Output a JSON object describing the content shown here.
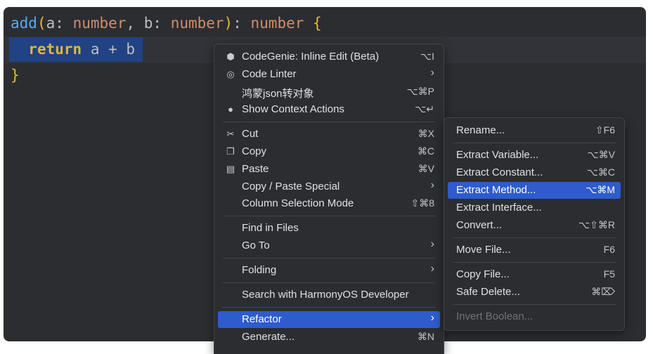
{
  "code": {
    "line1": {
      "fn": "add",
      "open": "(",
      "p1": "a",
      "colon1": ":",
      "t1": "number",
      "comma": ", ",
      "p2": "b",
      "colon2": ":",
      "t2": "number",
      "close": ")",
      "colon3": ":",
      "rt": "number",
      "brace": "{"
    },
    "line2": {
      "kw": "return",
      "expr": "a + b"
    },
    "line3": {
      "brace": "}"
    }
  },
  "context_menu": {
    "items": [
      {
        "label": "CodeGenie: Inline Edit (Beta)",
        "shortcut": "⌥I",
        "icon": "codegenie-icon"
      },
      {
        "label": "Code Linter",
        "icon": "code-linter-icon",
        "submenu": "›"
      },
      {
        "label": "鸿蒙json转对象",
        "shortcut": "⌥⌘P"
      },
      {
        "label": "Show Context Actions",
        "shortcut": "⌥↵",
        "icon": "bulb-icon"
      },
      {
        "label": "Cut",
        "shortcut": "⌘X",
        "icon": "scissors-icon"
      },
      {
        "label": "Copy",
        "shortcut": "⌘C",
        "icon": "copy-icon"
      },
      {
        "label": "Paste",
        "shortcut": "⌘V",
        "icon": "clipboard-icon"
      },
      {
        "label": "Copy / Paste Special",
        "submenu": "›"
      },
      {
        "label": "Column Selection Mode",
        "shortcut": "⇧⌘8"
      },
      {
        "label": "Find in Files"
      },
      {
        "label": "Go To",
        "submenu": "›"
      },
      {
        "label": "Folding",
        "submenu": "›"
      },
      {
        "label": "Search with HarmonyOS Developer"
      },
      {
        "label": "Refactor",
        "submenu": "›",
        "highlighted": true
      },
      {
        "label": "Generate...",
        "shortcut": "⌘N"
      }
    ]
  },
  "refactor_menu": {
    "items": [
      {
        "label": "Rename...",
        "shortcut": "⇧F6"
      },
      {
        "label": "Extract Variable...",
        "shortcut": "⌥⌘V"
      },
      {
        "label": "Extract Constant...",
        "shortcut": "⌥⌘C"
      },
      {
        "label": "Extract Method...",
        "shortcut": "⌥⌘M",
        "highlighted": true
      },
      {
        "label": "Extract Interface..."
      },
      {
        "label": "Convert...",
        "shortcut": "⌥⇧⌘R"
      },
      {
        "label": "Move File...",
        "shortcut": "F6"
      },
      {
        "label": "Copy File...",
        "shortcut": "F5"
      },
      {
        "label": "Safe Delete...",
        "shortcut": "⌘⌦"
      },
      {
        "label": "Invert Boolean...",
        "disabled": true
      }
    ]
  },
  "colors": {
    "highlight": "#2e5ccd",
    "menu_bg": "#2b2d30",
    "editor_bg": "#2b2d30",
    "selection": "#214283"
  }
}
